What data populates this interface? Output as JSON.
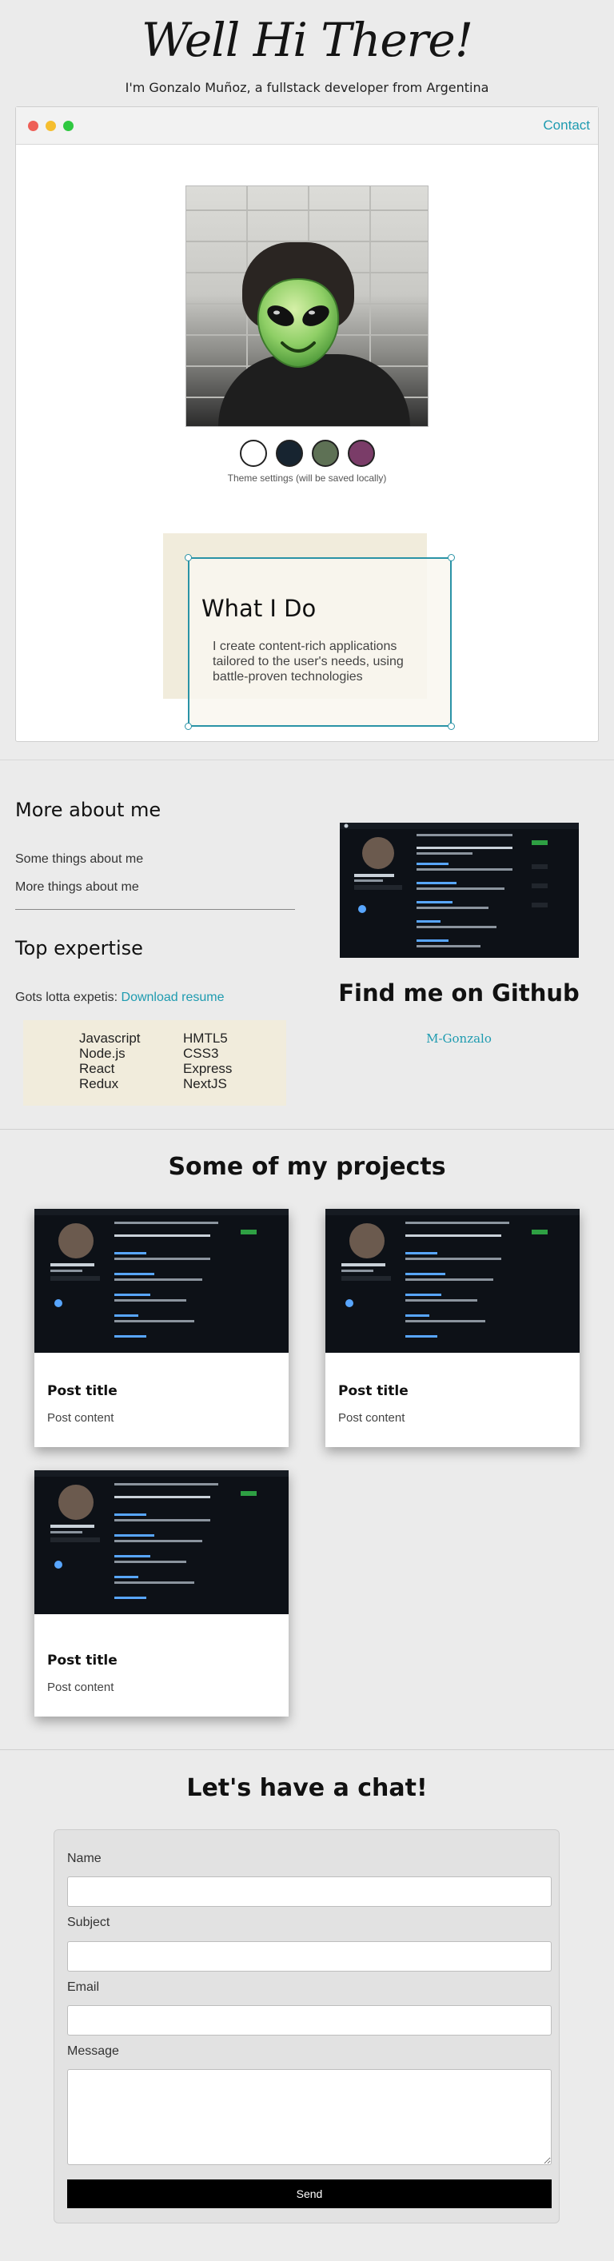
{
  "hero": {
    "title": "Well Hi There!",
    "subtitle": "I'm Gonzalo Muñoz, a fullstack developer from Argentina"
  },
  "window": {
    "contact_label": "Contact",
    "dot_colors": [
      "#ee5f57",
      "#f5be2f",
      "#2fc840"
    ]
  },
  "theme": {
    "swatches": [
      {
        "name": "white",
        "color": "#ffffff"
      },
      {
        "name": "navy",
        "color": "#172430"
      },
      {
        "name": "olive",
        "color": "#5e7155"
      },
      {
        "name": "plum",
        "color": "#7a3c68"
      }
    ],
    "note": "Theme settings (will be saved locally)"
  },
  "intro_card": {
    "title": "What I Do",
    "text": "I create content-rich applications tailored to the user's needs, using battle-proven technologies"
  },
  "about": {
    "heading": "More about me",
    "items": [
      "Some things about me",
      "More things about me"
    ],
    "expertise_heading": "Top expertise",
    "gots_text": "Gots lotta expetis: ",
    "resume_link": "Download resume",
    "skills_left": [
      "Javascript",
      "Node.js",
      "React",
      "Redux"
    ],
    "skills_right": [
      "HMTL5",
      "CSS3",
      "Express",
      "NextJS"
    ]
  },
  "github": {
    "title": "Find me on Github",
    "link_text": "M-Gonzalo"
  },
  "projects": {
    "heading": "Some of my projects",
    "posts": [
      {
        "title": "Post title",
        "content": "Post content"
      },
      {
        "title": "Post title",
        "content": "Post content"
      },
      {
        "title": "Post title",
        "content": "Post content"
      }
    ]
  },
  "chat": {
    "heading": "Let's have a chat!",
    "labels": {
      "name": "Name",
      "subject": "Subject",
      "email": "Email",
      "message": "Message"
    },
    "send_label": "Send"
  },
  "colors": {
    "accent": "#1e9bb0",
    "card_beige": "#f1ecdc",
    "page_bg": "#ebebeb"
  }
}
